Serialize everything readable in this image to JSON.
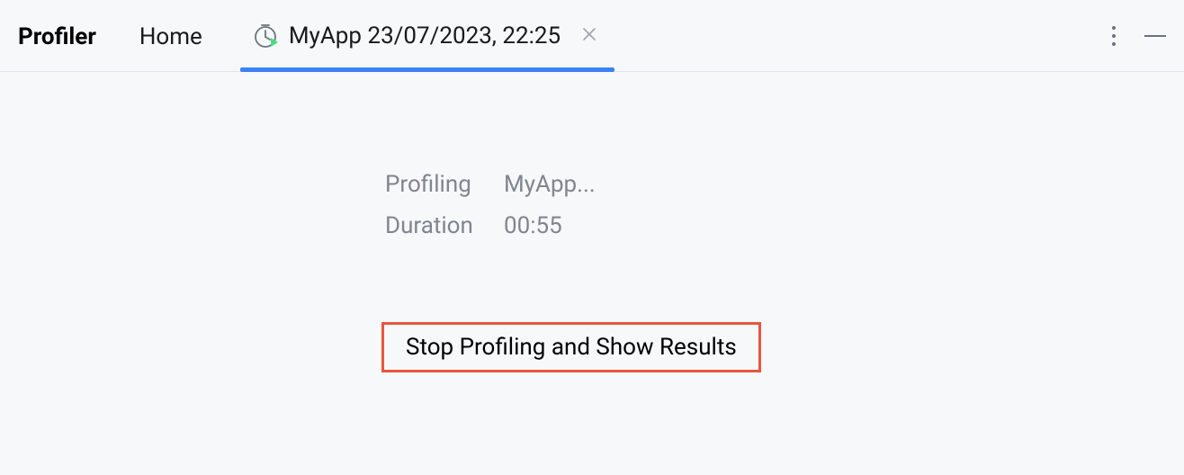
{
  "header": {
    "title": "Profiler",
    "home_label": "Home",
    "active_tab": {
      "label": "MyApp 23/07/2023, 22:25"
    }
  },
  "content": {
    "profiling_label": "Profiling",
    "profiling_value": "MyApp...",
    "duration_label": "Duration",
    "duration_value": "00:55",
    "stop_button_label": "Stop Profiling and Show Results"
  }
}
